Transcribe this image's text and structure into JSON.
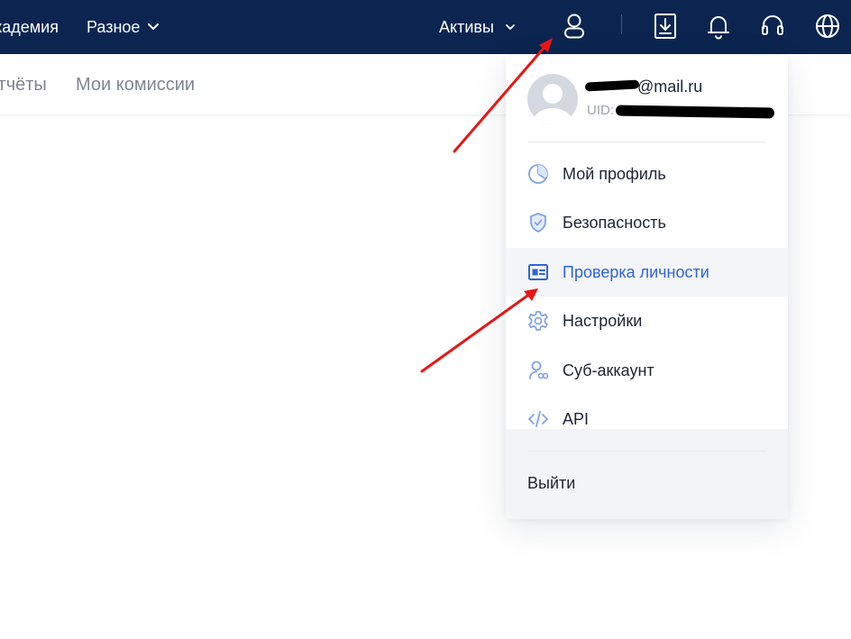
{
  "topbar": {
    "nav": {
      "academy": "Академия",
      "misc": "Разное",
      "assets": "Активы"
    },
    "icons": [
      "user-icon",
      "download-icon",
      "bell-icon",
      "headset-icon",
      "globe-icon"
    ]
  },
  "subnav": {
    "reports": "Отчёты",
    "commissions": "Мои комиссии"
  },
  "dropdown": {
    "email": "@mail.ru",
    "uid_label": "UID:",
    "menu": [
      {
        "label": "Мой профиль",
        "icon": "profile-chart-icon",
        "active": false
      },
      {
        "label": "Безопасность",
        "icon": "shield-check-icon",
        "active": false
      },
      {
        "label": "Проверка личности",
        "icon": "id-card-icon",
        "active": true
      },
      {
        "label": "Настройки",
        "icon": "gear-icon",
        "active": false
      },
      {
        "label": "Суб-аккаунт",
        "icon": "sub-account-icon",
        "active": false
      },
      {
        "label": "API",
        "icon": "code-icon",
        "active": false
      }
    ],
    "logout": "Выйти"
  },
  "colors": {
    "topbar_bg": "#0b2550",
    "accent": "#2f64d6",
    "icon_blue": "#7ea2e6",
    "annotation_red": "#e81616"
  }
}
